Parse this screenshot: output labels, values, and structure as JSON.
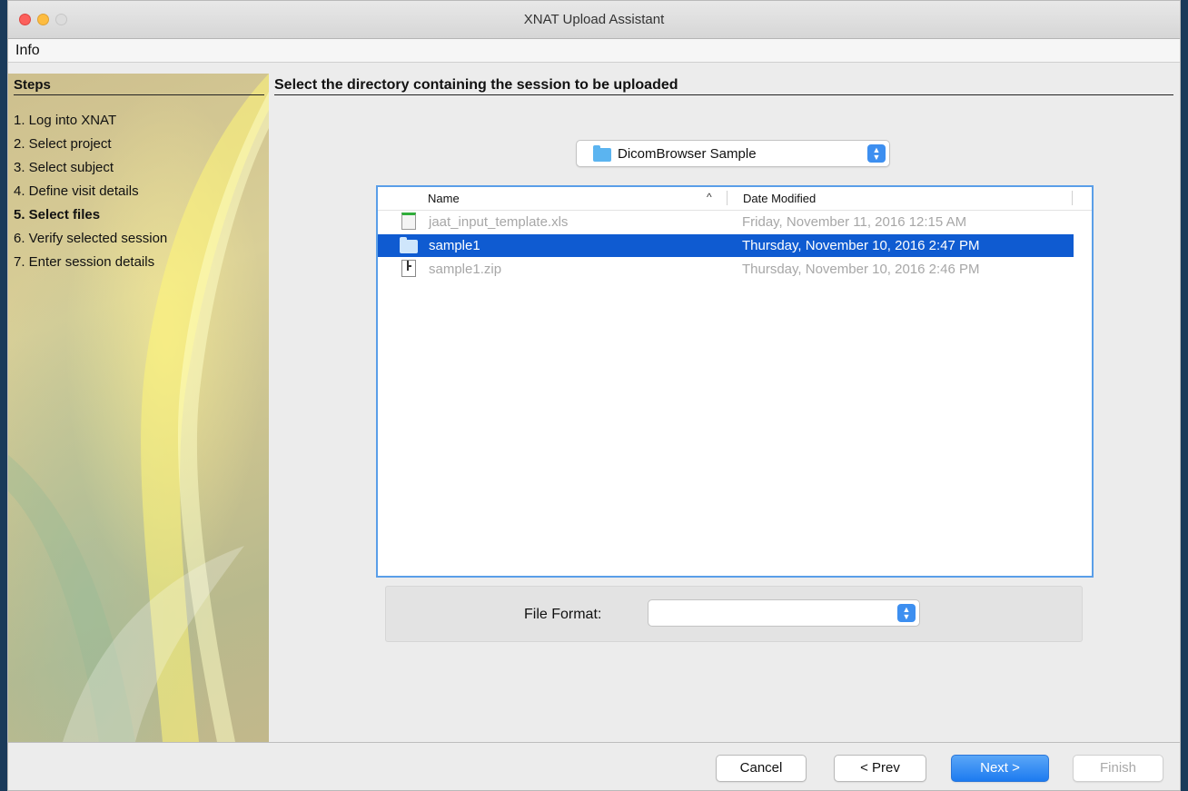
{
  "window": {
    "title": "XNAT Upload Assistant"
  },
  "menu": {
    "items": [
      {
        "label": "Info"
      }
    ]
  },
  "steps": {
    "heading": "Steps",
    "items": [
      {
        "label": "1. Log into XNAT"
      },
      {
        "label": "2. Select project"
      },
      {
        "label": "3. Select subject"
      },
      {
        "label": "4. Define visit details"
      },
      {
        "label": "5. Select files",
        "active": true
      },
      {
        "label": "6. Verify selected session"
      },
      {
        "label": "7. Enter session details"
      }
    ]
  },
  "main": {
    "heading": "Select the directory containing the session to be uploaded",
    "directory": {
      "selected": "DicomBrowser Sample",
      "icon": "folder-icon"
    },
    "file_list": {
      "columns": {
        "name": "Name",
        "date": "Date Modified",
        "sort_icon": "^"
      },
      "rows": [
        {
          "name": "jaat_input_template.xls",
          "date": "Friday, November 11, 2016 12:15 AM",
          "icon": "spreadsheet-icon",
          "state": "disabled"
        },
        {
          "name": "sample1",
          "date": "Thursday, November 10, 2016 2:47 PM",
          "icon": "folder-icon",
          "state": "selected"
        },
        {
          "name": "sample1.zip",
          "date": "Thursday, November 10, 2016 2:46 PM",
          "icon": "zip-icon",
          "state": "disabled"
        }
      ]
    },
    "file_format": {
      "label": "File Format:",
      "value": ""
    }
  },
  "buttons": {
    "cancel": "Cancel",
    "prev": "< Prev",
    "next": "Next >",
    "finish": "Finish"
  },
  "colors": {
    "accent": "#1d7bf0",
    "selection": "#0f5bd1",
    "folder": "#5bb4f0"
  }
}
